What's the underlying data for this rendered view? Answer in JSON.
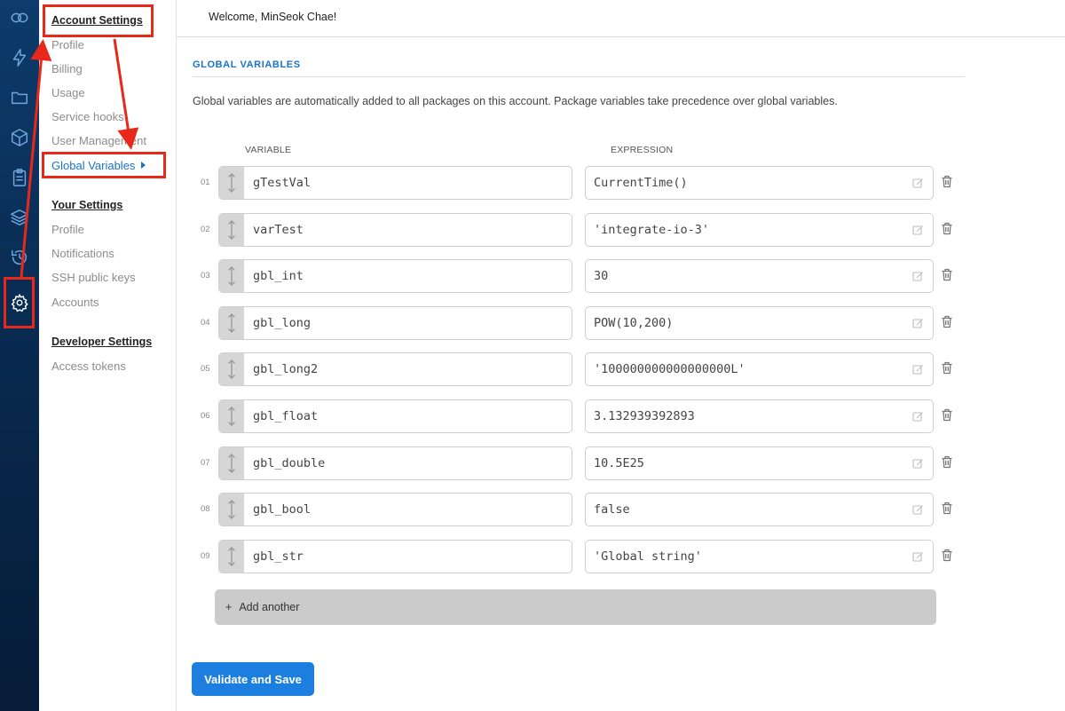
{
  "rail": {
    "icons": [
      "logo-icon",
      "lightning-icon",
      "folder-icon",
      "package-icon",
      "clipboard-icon",
      "layers-icon",
      "history-icon",
      "gear-icon"
    ]
  },
  "sidebar": {
    "account_title": "Account Settings",
    "account_items": [
      "Profile",
      "Billing",
      "Usage",
      "Service hooks",
      "User Management",
      "Global Variables"
    ],
    "your_title": "Your Settings",
    "your_items": [
      "Profile",
      "Notifications",
      "SSH public keys",
      "Accounts"
    ],
    "developer_title": "Developer Settings",
    "developer_items": [
      "Access tokens"
    ]
  },
  "header": {
    "welcome": "Welcome, MinSeok Chae!"
  },
  "main": {
    "section_title": "GLOBAL VARIABLES",
    "description": "Global variables are automatically added to all packages on this account. Package variables take precedence over global variables.",
    "col_variable": "VARIABLE",
    "col_expression": "EXPRESSION",
    "rows": [
      {
        "num": "01",
        "variable": "gTestVal",
        "expression": "CurrentTime()"
      },
      {
        "num": "02",
        "variable": "varTest",
        "expression": "'integrate-io-3'"
      },
      {
        "num": "03",
        "variable": "gbl_int",
        "expression": "30"
      },
      {
        "num": "04",
        "variable": "gbl_long",
        "expression": "POW(10,200)"
      },
      {
        "num": "05",
        "variable": "gbl_long2",
        "expression": "'100000000000000000L'"
      },
      {
        "num": "06",
        "variable": "gbl_float",
        "expression": "3.132939392893"
      },
      {
        "num": "07",
        "variable": "gbl_double",
        "expression": "10.5E25"
      },
      {
        "num": "08",
        "variable": "gbl_bool",
        "expression": "false"
      },
      {
        "num": "09",
        "variable": "gbl_str",
        "expression": "'Global string'"
      }
    ],
    "add_another": "Add another",
    "add_icon": "+",
    "save_label": "Validate and Save"
  },
  "colors": {
    "accent": "#1c7fe0",
    "annotation": "#e8281b",
    "rail": "#0a3260"
  }
}
